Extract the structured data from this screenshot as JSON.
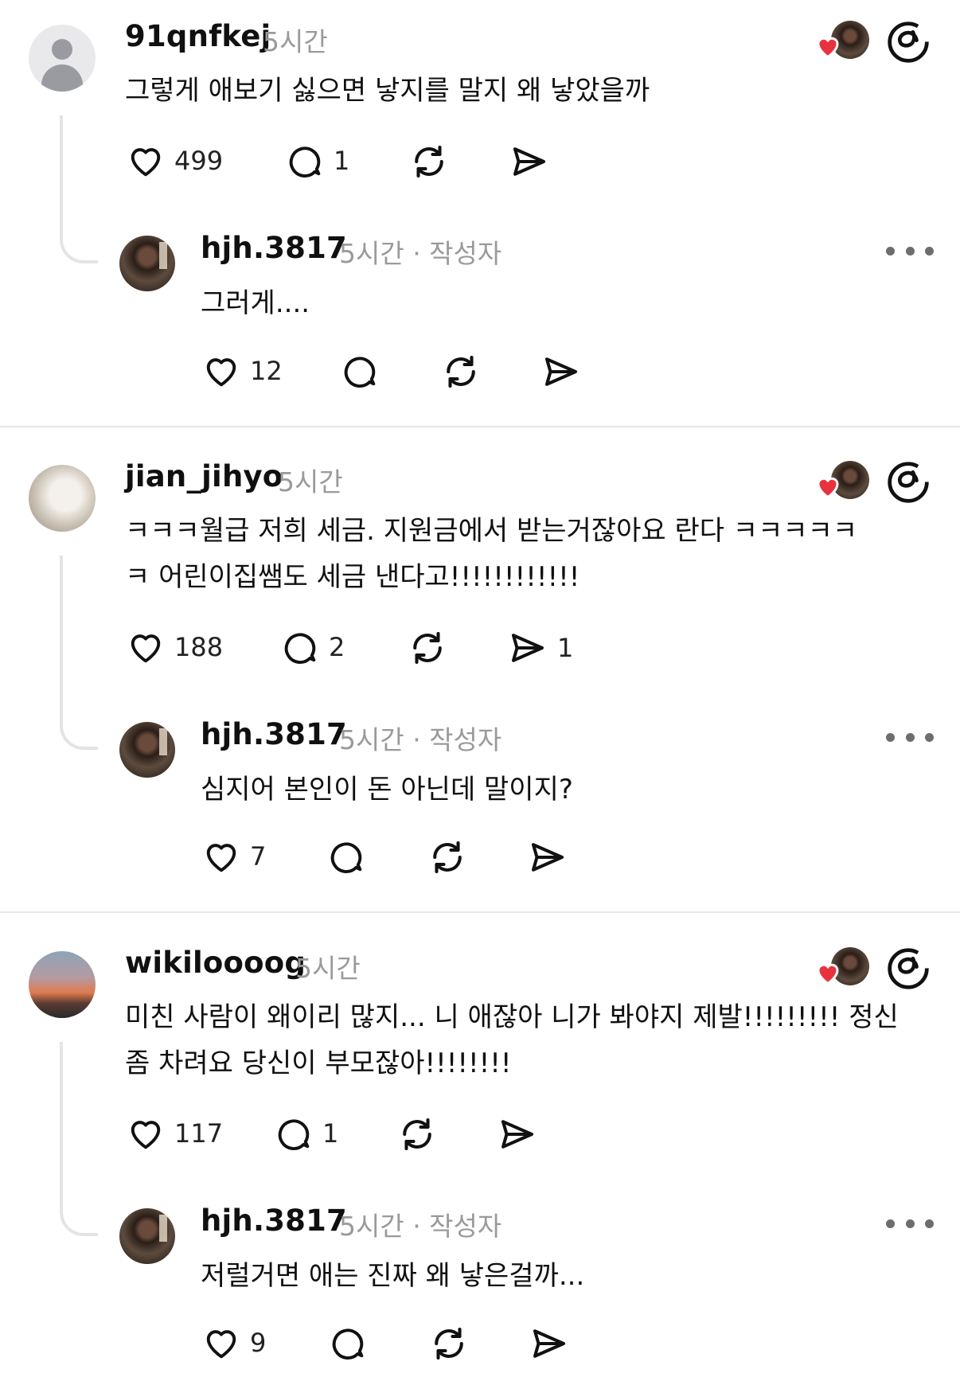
{
  "threads": [
    {
      "comment": {
        "username": "91qnfkej",
        "time": "5시간",
        "lines": [
          "그렇게 애보기 싫으면 낳지를 말지 왜 낳았을까"
        ],
        "likes": "499",
        "replies": "1",
        "shares": ""
      },
      "reply": {
        "username": "hjh.3817",
        "meta": "5시간 · 작성자",
        "lines": [
          "그러게...."
        ],
        "likes": "12"
      }
    },
    {
      "comment": {
        "username": "jian_jihyo",
        "time": "5시간",
        "lines": [
          "ㅋㅋㅋ월급 저희 세금. 지원금에서 받는거잖아요 란다 ㅋㅋㅋㅋㅋ",
          "ㅋ 어린이집쌤도 세금 낸다고!!!!!!!!!!!!"
        ],
        "likes": "188",
        "replies": "2",
        "shares": "1"
      },
      "reply": {
        "username": "hjh.3817",
        "meta": "5시간 · 작성자",
        "lines": [
          "심지어 본인이 돈 아닌데 말이지?"
        ],
        "likes": "7"
      }
    },
    {
      "comment": {
        "username": "wikiloooog",
        "time": "5시간",
        "lines": [
          "미친 사람이 왜이리 많지... 니 애잖아 니가 봐야지 제발!!!!!!!!! 정신",
          "좀 차려요 당신이 부모잖아!!!!!!!!"
        ],
        "likes": "117",
        "replies": "1",
        "shares": ""
      },
      "reply": {
        "username": "hjh.3817",
        "meta": "5시간 · 작성자",
        "lines": [
          "저럴거면 애는 진짜 왜 낳은걸까..."
        ],
        "likes": "9"
      }
    }
  ]
}
